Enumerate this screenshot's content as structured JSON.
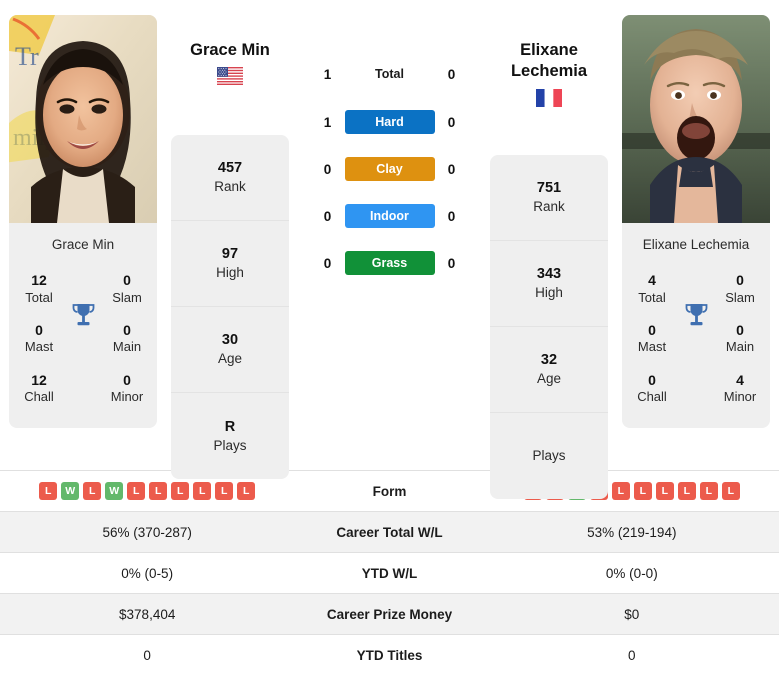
{
  "players": {
    "left": {
      "name": "Grace Min",
      "photo_caption": "Grace Min",
      "country_flag": "us-flag-icon",
      "titles": [
        {
          "num": "12",
          "label": "Total"
        },
        {
          "num": "0",
          "label": "Slam"
        },
        {
          "num": "0",
          "label": "Mast"
        },
        {
          "num": "0",
          "label": "Main"
        },
        {
          "num": "12",
          "label": "Chall"
        },
        {
          "num": "0",
          "label": "Minor"
        }
      ],
      "ranks": [
        {
          "num": "457",
          "label": "Rank"
        },
        {
          "num": "97",
          "label": "High"
        },
        {
          "num": "30",
          "label": "Age"
        },
        {
          "num": "R",
          "label": "Plays"
        }
      ],
      "form": [
        "L",
        "W",
        "L",
        "W",
        "L",
        "L",
        "L",
        "L",
        "L",
        "L"
      ],
      "career_total_wl": "56% (370-287)",
      "ytd_wl": "0% (0-5)",
      "career_prize_money": "$378,404",
      "ytd_titles": "0"
    },
    "right": {
      "name": "Elixane Lechemia",
      "photo_caption": "Elixane Lechemia",
      "country_flag": "fr-flag-icon",
      "titles": [
        {
          "num": "4",
          "label": "Total"
        },
        {
          "num": "0",
          "label": "Slam"
        },
        {
          "num": "0",
          "label": "Mast"
        },
        {
          "num": "0",
          "label": "Main"
        },
        {
          "num": "0",
          "label": "Chall"
        },
        {
          "num": "4",
          "label": "Minor"
        }
      ],
      "ranks": [
        {
          "num": "751",
          "label": "Rank"
        },
        {
          "num": "343",
          "label": "High"
        },
        {
          "num": "32",
          "label": "Age"
        },
        {
          "num": "",
          "label": "Plays"
        }
      ],
      "form": [
        "L",
        "L",
        "W",
        "L",
        "L",
        "L",
        "L",
        "L",
        "L",
        "L"
      ],
      "career_total_wl": "53% (219-194)",
      "ytd_wl": "0% (0-0)",
      "career_prize_money": "$0",
      "ytd_titles": "0"
    }
  },
  "head_to_head": [
    {
      "label": "Total",
      "left": "1",
      "right": "0",
      "type": "text",
      "color": ""
    },
    {
      "label": "Hard",
      "left": "1",
      "right": "0",
      "type": "pill",
      "color": "#0b72c4"
    },
    {
      "label": "Clay",
      "left": "0",
      "right": "0",
      "type": "pill",
      "color": "#de9110"
    },
    {
      "label": "Indoor",
      "left": "0",
      "right": "0",
      "type": "pill",
      "color": "#2f95f2"
    },
    {
      "label": "Grass",
      "left": "0",
      "right": "0",
      "type": "pill",
      "color": "#119138"
    }
  ],
  "table_rows": [
    {
      "label": "Form",
      "key": "form",
      "kind": "form",
      "shaded": false
    },
    {
      "label": "Career Total W/L",
      "key": "career_total_wl",
      "kind": "text",
      "shaded": true
    },
    {
      "label": "YTD W/L",
      "key": "ytd_wl",
      "kind": "text",
      "shaded": false
    },
    {
      "label": "Career Prize Money",
      "key": "career_prize_money",
      "kind": "text",
      "shaded": true
    },
    {
      "label": "YTD Titles",
      "key": "ytd_titles",
      "kind": "text",
      "shaded": false
    }
  ],
  "colors": {
    "card_bg": "#efefef",
    "win": "#63b86b",
    "loss": "#ec5b4c",
    "trophy": "#3f6fb0",
    "row_shade": "#f2f2f2"
  }
}
